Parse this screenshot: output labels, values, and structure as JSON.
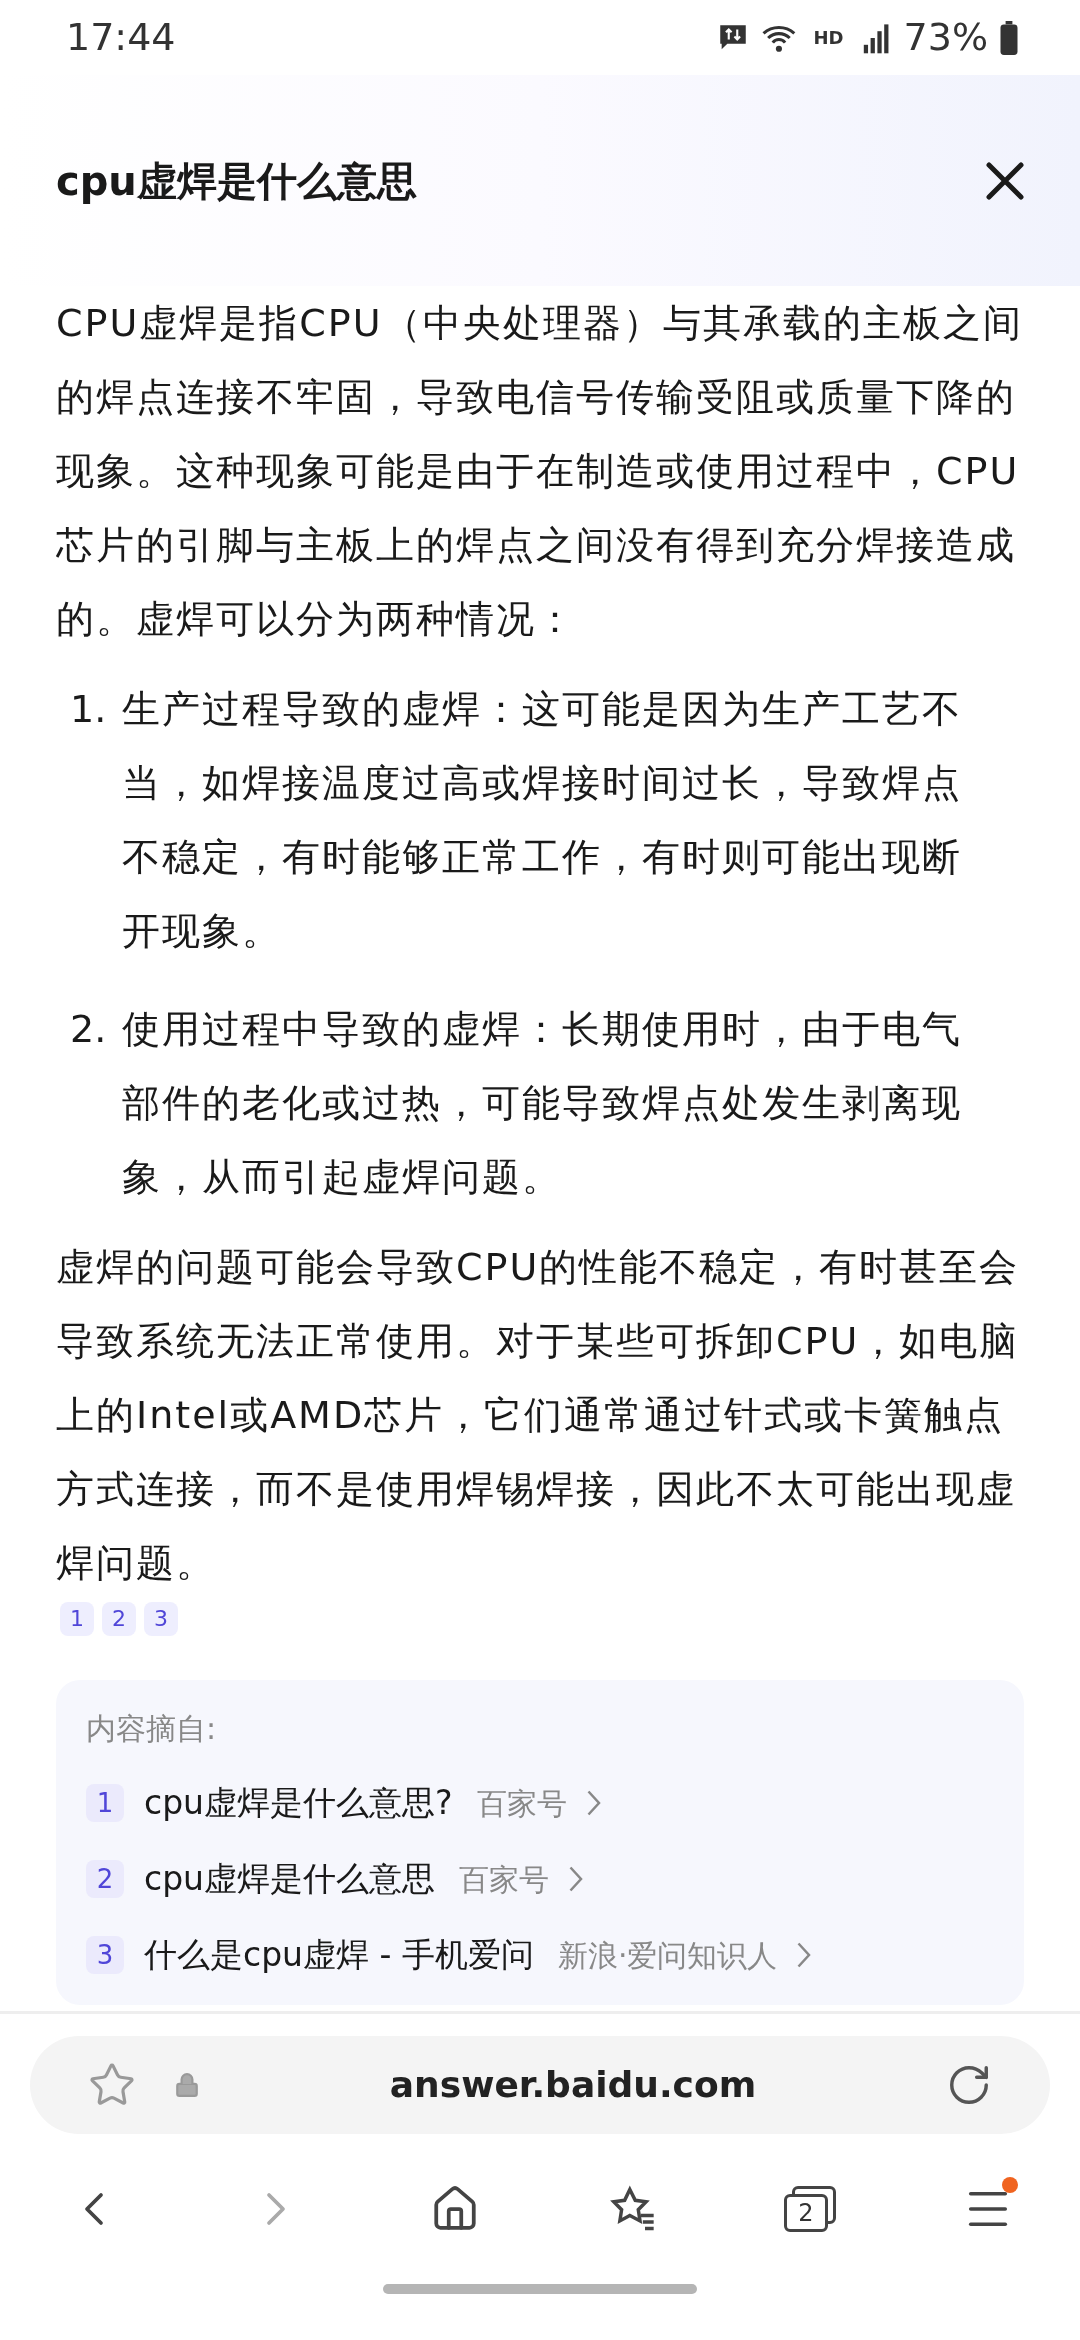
{
  "status_bar": {
    "time": "17:44",
    "network": "HD",
    "battery": "73%"
  },
  "header": {
    "title": "cpu虚焊是什么意思"
  },
  "answer": {
    "intro": "CPU虚焊是指CPU（中央处理器）与其承载的主板之间的焊点连接不牢固，导致电信号传输受阻或质量下降的现象。这种现象可能是由于在制造或使用过程中，CPU芯片的引脚与主板上的焊点之间没有得到充分焊接造成的。虚焊可以分为两种情况：",
    "list": [
      {
        "number": "1.",
        "text": "生产过程导致的虚焊：这可能是因为生产工艺不当，如焊接温度过高或焊接时间过长，导致焊点不稳定，有时能够正常工作，有时则可能出现断开现象。"
      },
      {
        "number": "2.",
        "text": "使用过程中导致的虚焊：长期使用时，由于电气部件的老化或过热，可能导致焊点处发生剥离现象，从而引起虚焊问题。"
      }
    ],
    "conclusion": "虚焊的问题可能会导致CPU的性能不稳定，有时甚至会导致系统无法正常使用。对于某些可拆卸CPU，如电脑上的Intel或AMD芯片，它们通常通过针式或卡簧触点方式连接，而不是使用焊锡焊接，因此不太可能出现虚焊问题。",
    "citations": [
      "1",
      "2",
      "3"
    ]
  },
  "sources": {
    "heading": "内容摘自:",
    "items": [
      {
        "number": "1",
        "title": "cpu虚焊是什么意思?",
        "site": "百家号"
      },
      {
        "number": "2",
        "title": "cpu虚焊是什么意思",
        "site": "百家号"
      },
      {
        "number": "3",
        "title": "什么是cpu虚焊 - 手机爱问",
        "site": "新浪·爱问知识人"
      }
    ]
  },
  "address_bar": {
    "url": "answer.baidu.com"
  },
  "bottom_nav": {
    "tab_count": "2",
    "menu_badge": true
  }
}
